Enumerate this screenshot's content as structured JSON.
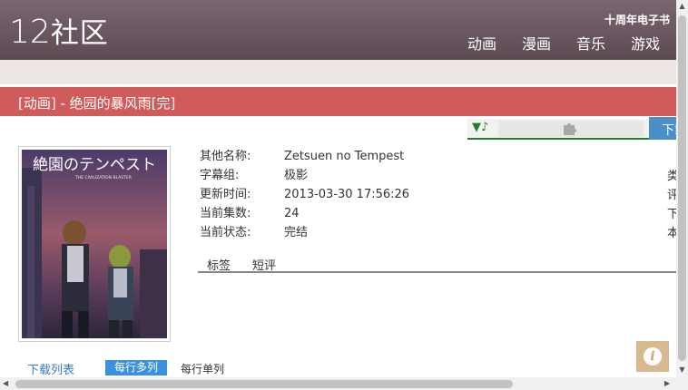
{
  "header": {
    "logo_num": "12",
    "logo_text": "社区",
    "anniversary": "十周年电子书",
    "nav": [
      "动画",
      "漫画",
      "音乐",
      "游戏"
    ]
  },
  "title_bar": "[动画] - 绝园的暴风雨[完]",
  "player": {
    "note": "▼♪",
    "download": "下载"
  },
  "cover": {
    "title_jp": "絶園のテンペスト",
    "subtitle": "THE CIVILIZATION BLASTER"
  },
  "info": [
    {
      "label": "其他名称:",
      "value": "Zetsuen no Tempest"
    },
    {
      "label": "字幕组:",
      "value": "极影"
    },
    {
      "label": "更新时间:",
      "value": "2013-03-30 17:56:26"
    },
    {
      "label": "当前集数:",
      "value": "24"
    },
    {
      "label": "当前状态:",
      "value": "完结"
    }
  ],
  "right_col": [
    "类",
    "评",
    "下",
    "本"
  ],
  "tabs": [
    "标签",
    "短评"
  ],
  "download_list": "下载列表",
  "modes": [
    "每行多列",
    "每行单列"
  ],
  "info_button": "i",
  "colors": {
    "header": "#6b5760",
    "title_bar": "#cf5b5b",
    "accent_blue": "#3a91e0"
  }
}
